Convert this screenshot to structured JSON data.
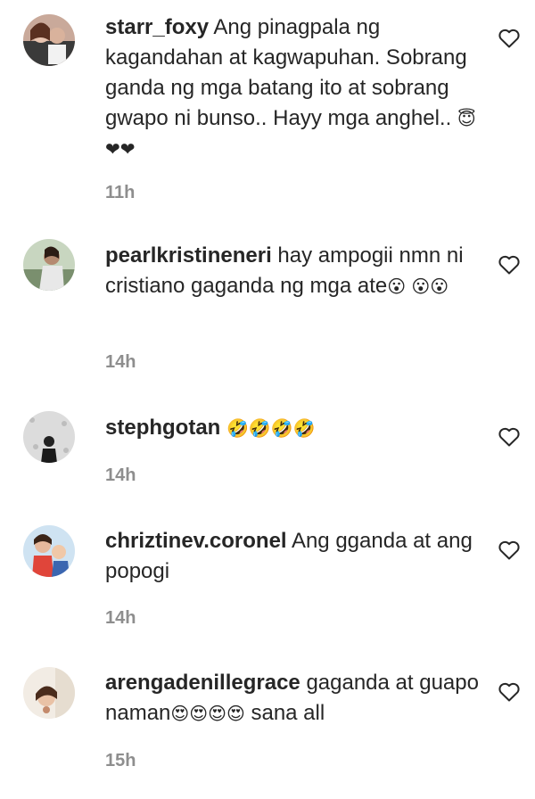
{
  "comments": [
    {
      "username": "starr_foxy",
      "text": "Ang pinagpala ng kagandahan at kagwapuhan. Sobrang ganda ng mga batang ito at sobrang gwapo ni bunso.. Hayy mga anghel..",
      "emoji": "😇 ❤❤",
      "time": "11h"
    },
    {
      "username": "pearlkristineneri",
      "text": "hay ampogii nmn ni cristiano gaganda ng mga ate",
      "emoji": "😮 😮😮",
      "time": "14h"
    },
    {
      "username": "stephgotan",
      "text": "",
      "emoji": "🤣🤣🤣🤣",
      "time": "14h"
    },
    {
      "username": "chriztinev.coronel",
      "text": "Ang gganda at ang popogi",
      "emoji": "",
      "time": "14h"
    },
    {
      "username": "arengadenillegrace",
      "text": "gaganda at guapo naman",
      "emoji": "😍😍😍😍",
      "text_after": "sana all",
      "time": "15h"
    }
  ],
  "colors": {
    "text": "#262626",
    "secondary": "#8e8e8e",
    "background": "#ffffff"
  },
  "icons": {
    "like": "heart-outline-icon"
  }
}
